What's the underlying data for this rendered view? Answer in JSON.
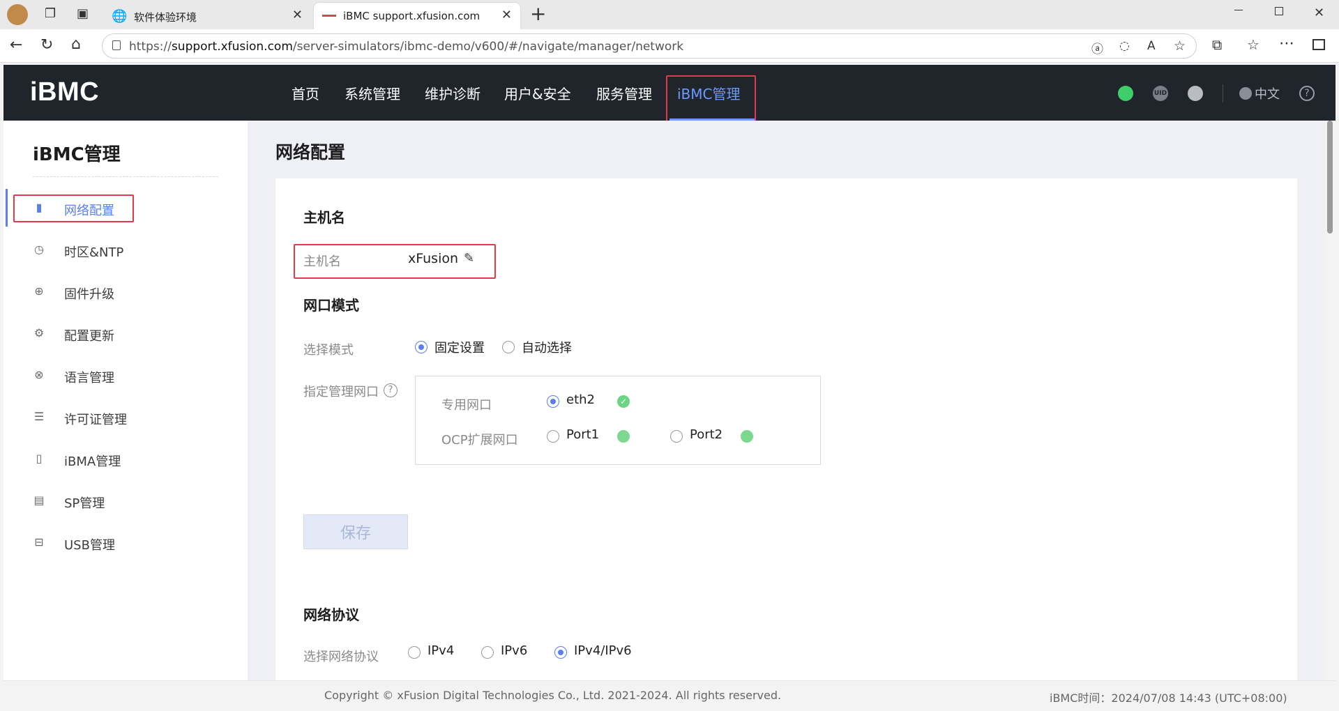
{
  "browser": {
    "tabs": [
      {
        "title": "软件体验环境",
        "active": false
      },
      {
        "title": "iBMC support.xfusion.com",
        "active": true
      }
    ],
    "new_tab_symbol": "+",
    "close_symbol": "✕",
    "url_prefix": "https://",
    "url_host": "support.xfusion.com",
    "url_path": "/server-simulators/ibmc-demo/v600/#/navigate/manager/network"
  },
  "header": {
    "logo": "iBMC",
    "nav": [
      {
        "label": "首页"
      },
      {
        "label": "系统管理"
      },
      {
        "label": "维护诊断"
      },
      {
        "label": "用户&安全"
      },
      {
        "label": "服务管理"
      },
      {
        "label": "iBMC管理",
        "active": true
      }
    ],
    "uid_label": "UID",
    "language": "中文",
    "help_symbol": "?",
    "colors": {
      "background": "#20242b",
      "active_nav": "#6b9bff",
      "power": "#3fcf6a"
    }
  },
  "sidebar": {
    "title": "iBMC管理",
    "items": [
      {
        "label": "网络配置",
        "icon": "signal-bars-icon",
        "active": true
      },
      {
        "label": "时区&NTP",
        "icon": "clock-icon"
      },
      {
        "label": "固件升级",
        "icon": "upload-circle-icon"
      },
      {
        "label": "配置更新",
        "icon": "gear-icon"
      },
      {
        "label": "语言管理",
        "icon": "globe-icon"
      },
      {
        "label": "许可证管理",
        "icon": "document-icon"
      },
      {
        "label": "iBMA管理",
        "icon": "info-box-icon"
      },
      {
        "label": "SP管理",
        "icon": "printer-icon"
      },
      {
        "label": "USB管理",
        "icon": "usb-drive-icon"
      }
    ]
  },
  "main": {
    "page_title": "网络配置",
    "hostname_section": {
      "title": "主机名",
      "label": "主机名",
      "value": "xFusion"
    },
    "port_mode_section": {
      "title": "网口模式",
      "select_mode_label": "选择模式",
      "modes": [
        {
          "label": "固定设置",
          "checked": true
        },
        {
          "label": "自动选择",
          "checked": false
        }
      ],
      "assign_port_label": "指定管理网口",
      "dedicated_label": "专用网口",
      "dedicated_port": {
        "label": "eth2",
        "checked": true
      },
      "ocp_label": "OCP扩展网口",
      "ocp_ports": [
        {
          "label": "Port1",
          "checked": false
        },
        {
          "label": "Port2",
          "checked": false
        }
      ]
    },
    "save_label": "保存",
    "protocol_section": {
      "title": "网络协议",
      "select_label": "选择网络协议",
      "options": [
        {
          "label": "IPv4",
          "checked": false
        },
        {
          "label": "IPv6",
          "checked": false
        },
        {
          "label": "IPv4/IPv6",
          "checked": true
        }
      ]
    }
  },
  "footer": {
    "copyright": "Copyright © xFusion Digital Technologies Co., Ltd. 2021-2024. All rights reserved.",
    "time_label": "iBMC时间：",
    "time_value": "2024/07/08 14:43 (UTC+08:00)"
  }
}
